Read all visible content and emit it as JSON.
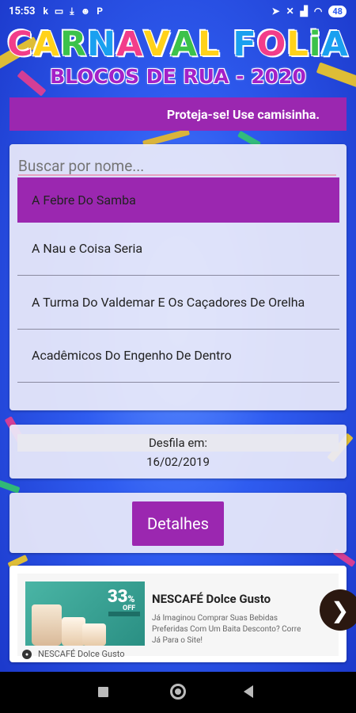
{
  "status_bar": {
    "time": "15:53",
    "left_icons": [
      "k",
      "laptop-icon",
      "download-icon",
      "alien-icon",
      "p-icon"
    ],
    "battery": "48"
  },
  "header": {
    "title_letters": [
      {
        "ch": "C",
        "color": "#f23d8a"
      },
      {
        "ch": "A",
        "color": "#ffd21a"
      },
      {
        "ch": "R",
        "color": "#3cc24a"
      },
      {
        "ch": "N",
        "color": "#1aa0f0"
      },
      {
        "ch": "A",
        "color": "#f23d8a"
      },
      {
        "ch": "V",
        "color": "#ffd21a"
      },
      {
        "ch": "A",
        "color": "#3cc24a"
      },
      {
        "ch": "L",
        "color": "#ffd21a"
      },
      {
        "ch": " ",
        "color": "#ffffff"
      },
      {
        "ch": "F",
        "color": "#1aa0f0"
      },
      {
        "ch": "O",
        "color": "#f23d8a"
      },
      {
        "ch": "L",
        "color": "#ffd21a"
      },
      {
        "ch": "i",
        "color": "#3cc24a"
      },
      {
        "ch": "A",
        "color": "#1aa0f0"
      }
    ],
    "subtitle": "BLOCOS DE RUA - 2020"
  },
  "banner": {
    "text": "Proteja-se! Use camisinha."
  },
  "search": {
    "placeholder": "Buscar por nome..."
  },
  "list": {
    "items": [
      "A Febre Do Samba",
      "A Nau e Coisa Seria",
      "A Turma Do Valdemar E Os Caçadores De Orelha",
      "Acadêmicos Do Engenho De Dentro"
    ]
  },
  "parade": {
    "label": "Desfila em:",
    "date": "16/02/2019"
  },
  "actions": {
    "details_label": "Detalhes"
  },
  "ad": {
    "discount": "33",
    "percent": "%",
    "off": "OFF",
    "title": "NESCAFÉ Dolce Gusto",
    "description": "Já Imaginou Comprar Suas Bebidas Preferidas Com Um Baita Desconto? Corre Já Para o Site!",
    "advertiser": "NESCAFÉ Dolce Gusto",
    "arrow": "❯"
  },
  "colors": {
    "accent": "#9b27b0",
    "background": "#2f5cf0"
  }
}
